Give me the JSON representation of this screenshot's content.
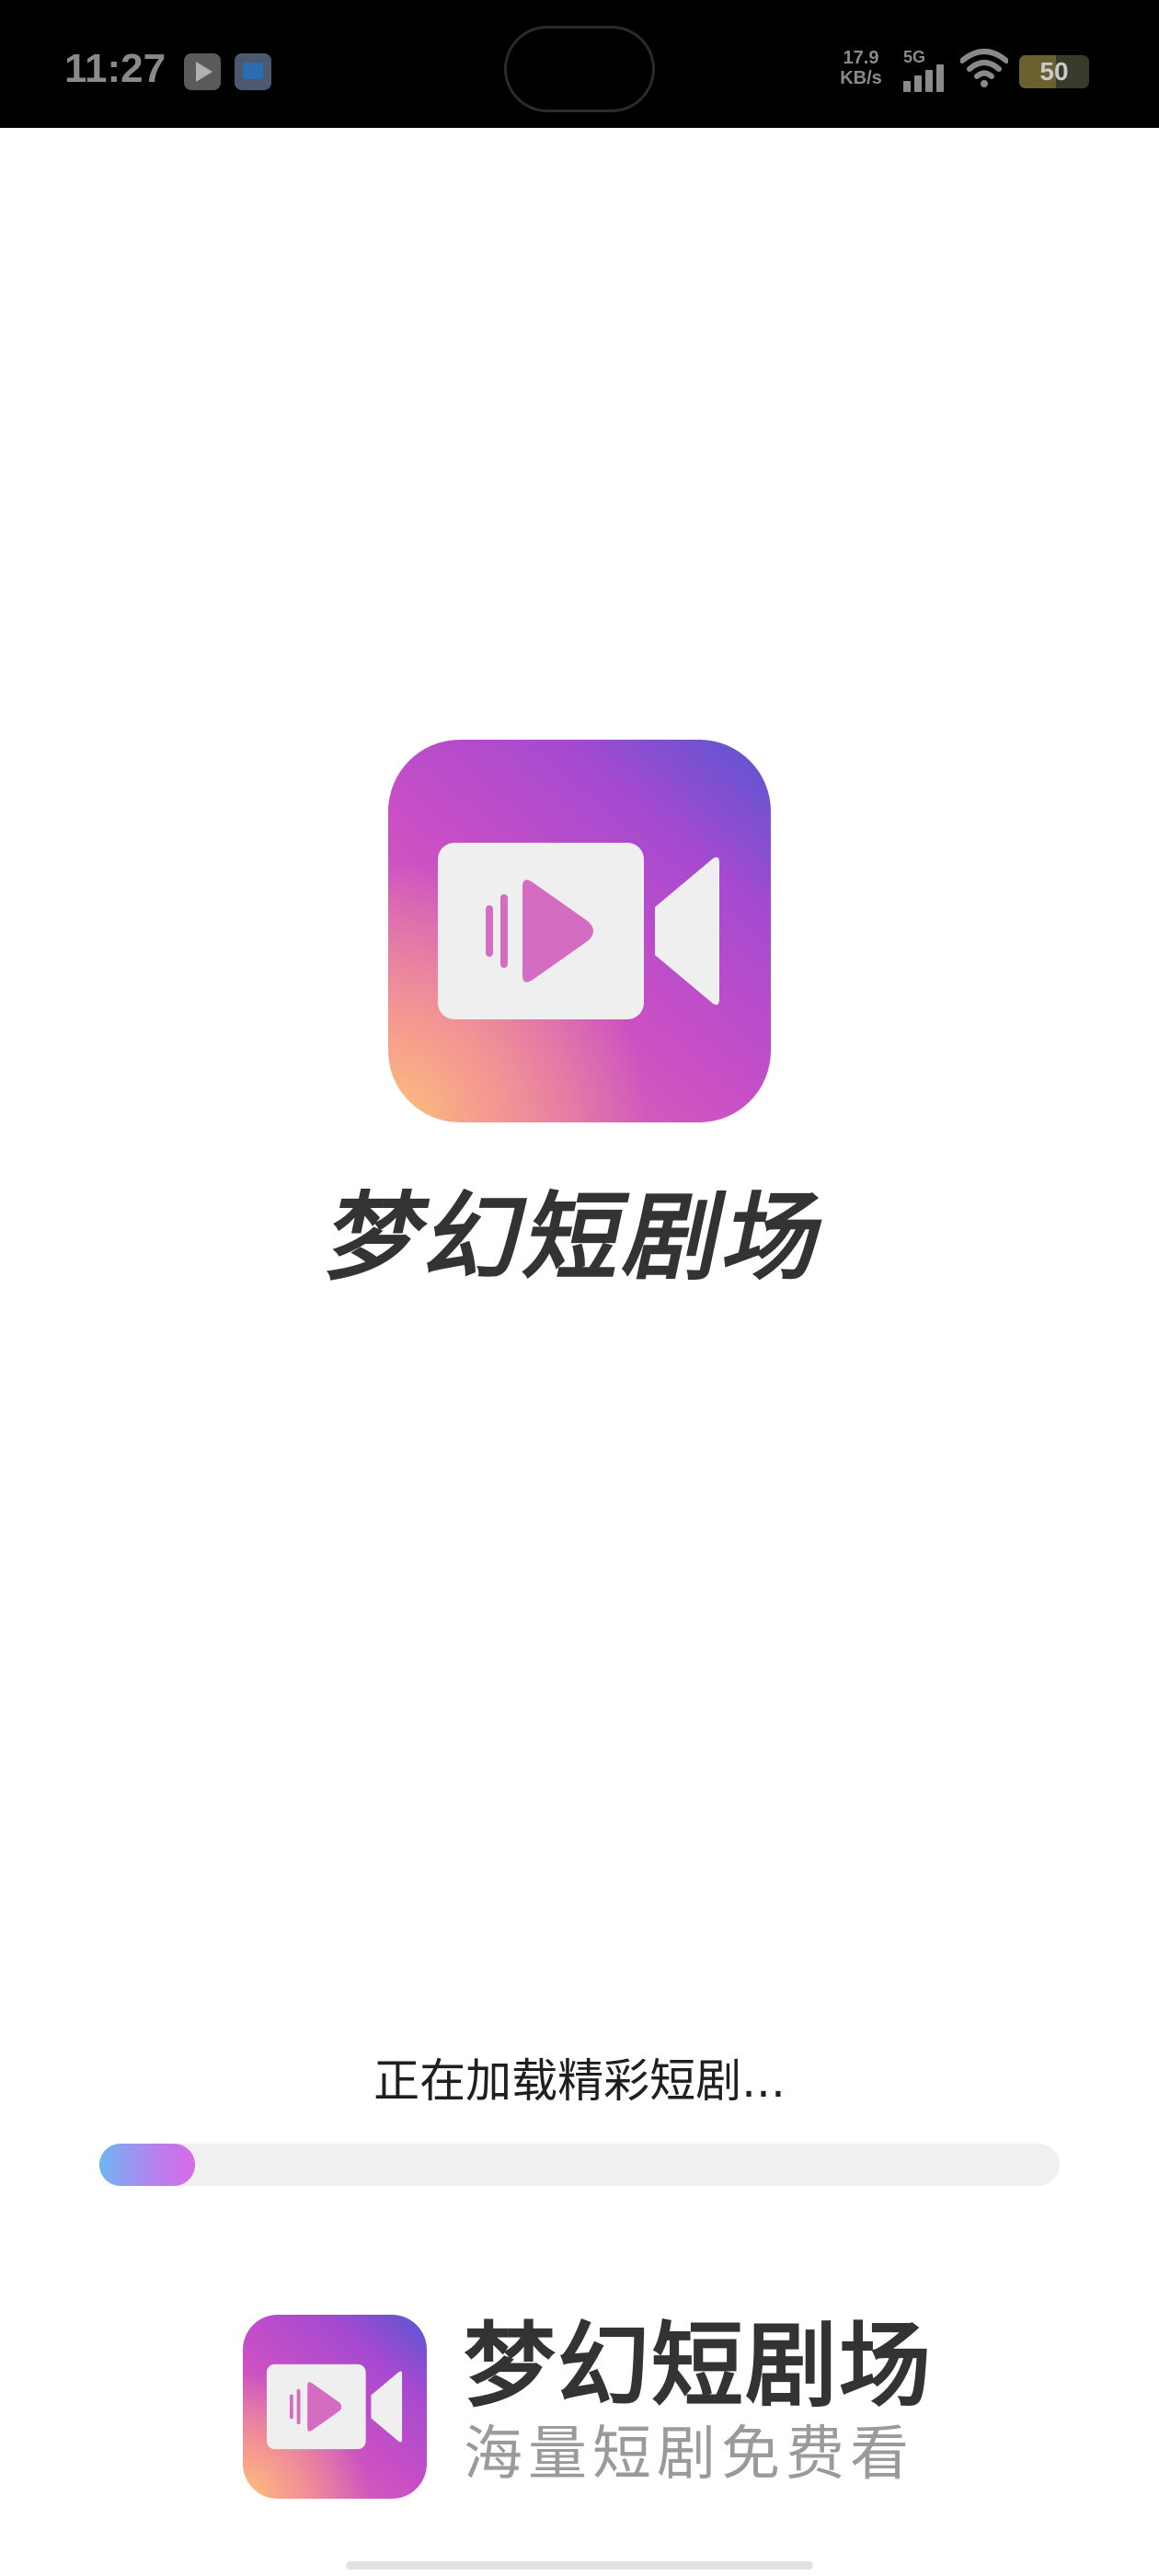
{
  "status_bar": {
    "time": "11:27",
    "net_speed_value": "17.9",
    "net_speed_unit": "KB/s",
    "network_type": "5G",
    "battery_level": "50",
    "notification_icons": [
      "play-store-icon",
      "app-notification-icon"
    ]
  },
  "splash": {
    "app_name": "梦幻短剧场",
    "logo_icon": "video-camera-icon"
  },
  "loading": {
    "text": "正在加载精彩短剧...",
    "progress_fraction": 0.1
  },
  "brand": {
    "name": "梦幻短剧场",
    "slogan": "海量短剧免费看"
  },
  "colors": {
    "logo_gradient_start": "#f9c27a",
    "logo_gradient_mid": "#c94fc5",
    "logo_gradient_end": "#5656d2",
    "progress_start": "#6fb6f2",
    "progress_end": "#d86ae6",
    "progress_track": "#f0f0f0"
  }
}
